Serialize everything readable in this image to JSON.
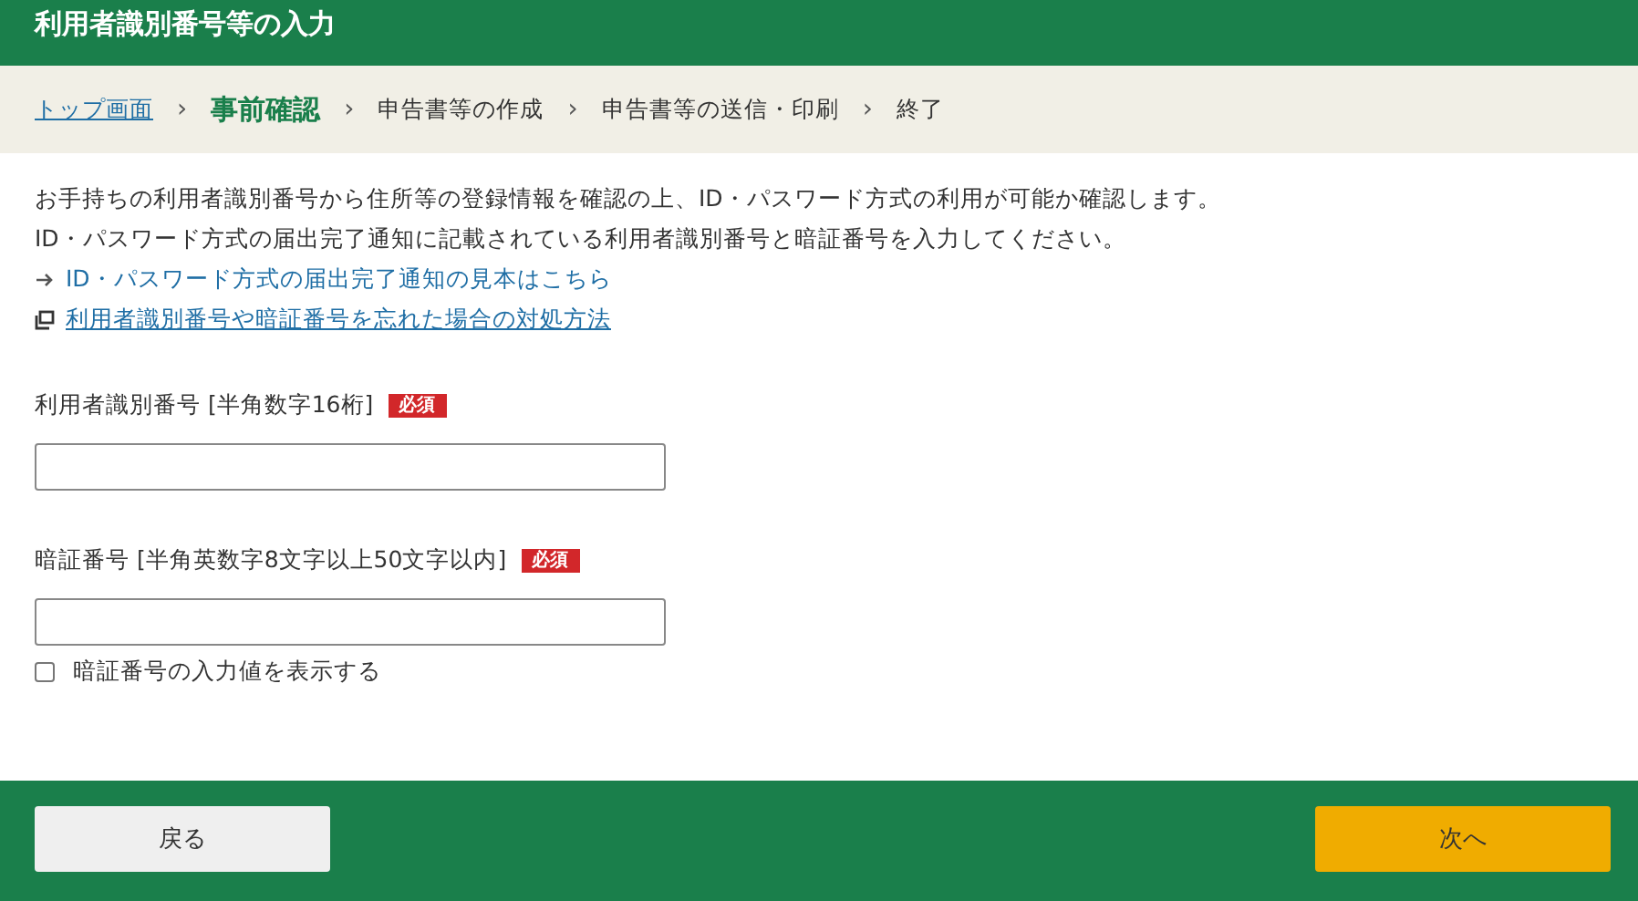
{
  "header": {
    "title": "利用者識別番号等の入力"
  },
  "breadcrumb": [
    {
      "label": "トップ画面",
      "kind": "link"
    },
    {
      "label": "事前確認",
      "kind": "current"
    },
    {
      "label": "申告書等の作成",
      "kind": "step"
    },
    {
      "label": "申告書等の送信・印刷",
      "kind": "step"
    },
    {
      "label": "終了",
      "kind": "step"
    }
  ],
  "breadcrumb_separator": "›",
  "intro": [
    "お手持ちの利用者識別番号から住所等の登録情報を確認の上、ID・パスワード方式の利用が可能か確認します。",
    "ID・パスワード方式の届出完了通知に記載されている利用者識別番号と暗証番号を入力してください。"
  ],
  "links": [
    {
      "label": "ID・パスワード方式の届出完了通知の見本はこちら",
      "kind": "arrow"
    },
    {
      "label": "利用者識別番号や暗証番号を忘れた場合の対処方法",
      "kind": "window"
    }
  ],
  "fields": [
    {
      "label": "利用者識別番号 [半角数字16桁]",
      "badge": "必須"
    },
    {
      "label": "暗証番号 [半角英数字8文字以上50文字以内]",
      "badge": "必須"
    }
  ],
  "show_password": {
    "label": "暗証番号の入力値を表示する",
    "checked": false
  },
  "footer": {
    "back": "戻る",
    "next": "次へ"
  }
}
